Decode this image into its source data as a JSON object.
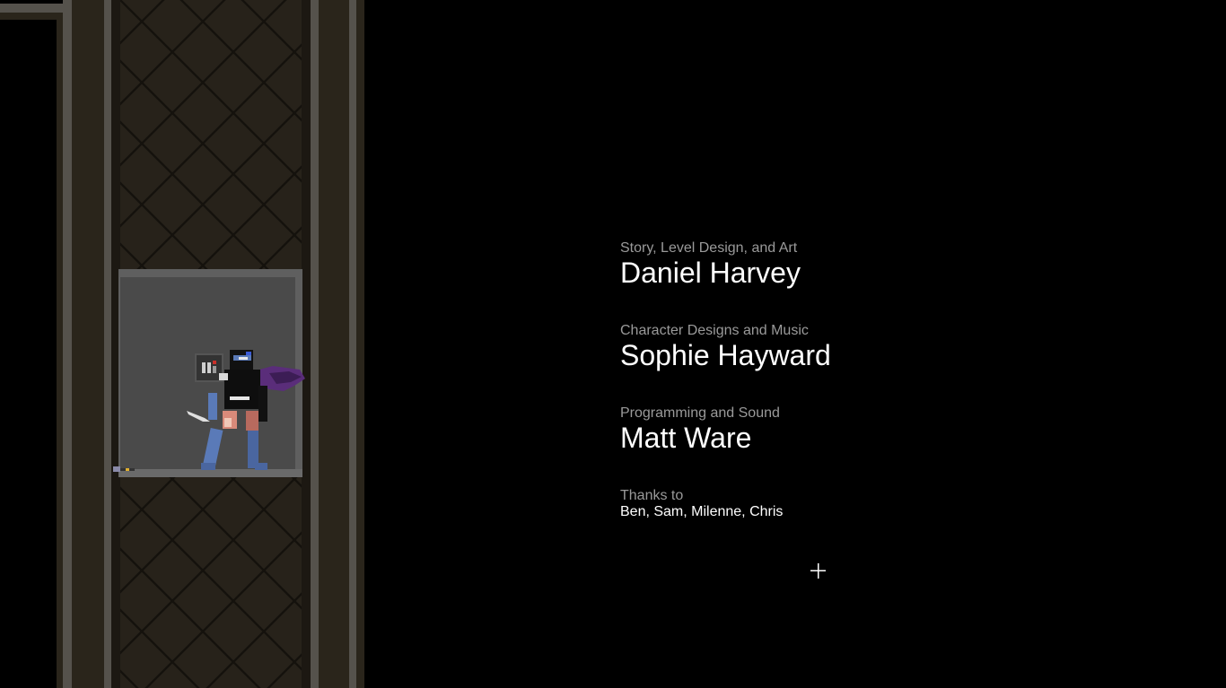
{
  "credits": [
    {
      "role": "Story, Level Design, and Art",
      "name": "Daniel Harvey"
    },
    {
      "role": "Character Designs and Music",
      "name": "Sophie Hayward"
    },
    {
      "role": "Programming and Sound",
      "name": "Matt Ware"
    }
  ],
  "thanks": {
    "label": "Thanks to",
    "names": "Ben, Sam, Milenne, Chris"
  },
  "colors": {
    "background": "#000000",
    "wall": "#2a251b",
    "pillar": "#55524c",
    "elevator": "#4a4a4a",
    "cape": "#5a2d7a",
    "armor_blue": "#5a7ab8",
    "role_text": "#9a9a9a",
    "name_text": "#ffffff"
  },
  "icons": {
    "cursor": "crosshair-cursor-icon"
  }
}
